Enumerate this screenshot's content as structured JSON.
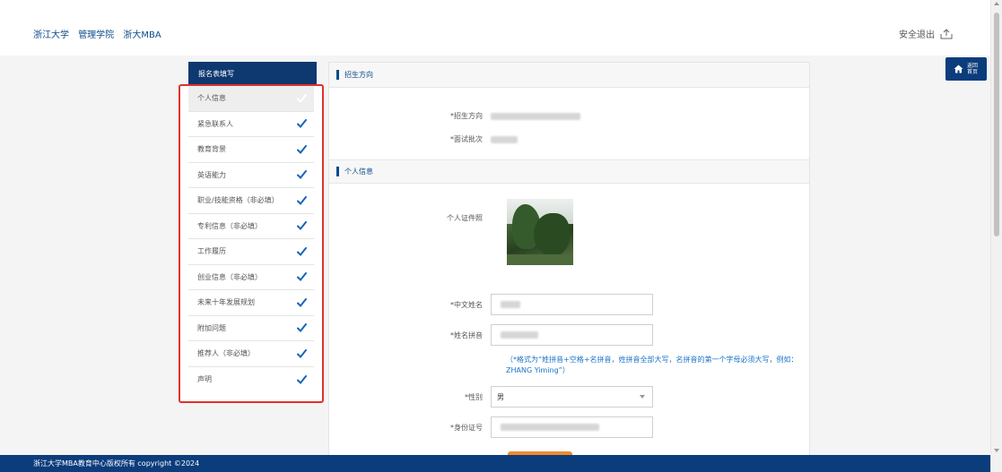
{
  "header": {
    "links": [
      "浙江大学",
      "管理学院",
      "浙大MBA"
    ],
    "logout_label": "安全退出"
  },
  "home_button": {
    "label": "返回首页"
  },
  "sidebar": {
    "title": "报名表填写",
    "items": [
      {
        "label": "个人信息",
        "done": true,
        "active": true
      },
      {
        "label": "紧急联系人",
        "done": true
      },
      {
        "label": "教育背景",
        "done": true
      },
      {
        "label": "英语能力",
        "done": true
      },
      {
        "label": "职业/技能资格（非必填）",
        "done": true
      },
      {
        "label": "专利信息（非必填）",
        "done": true
      },
      {
        "label": "工作履历",
        "done": true
      },
      {
        "label": "创业信息（非必填）",
        "done": true
      },
      {
        "label": "未来十年发展规划",
        "done": true
      },
      {
        "label": "附加问题",
        "done": true
      },
      {
        "label": "推荐人（非必填）",
        "done": true
      },
      {
        "label": "声明",
        "done": true
      }
    ]
  },
  "sections": {
    "direction": {
      "title": "招生方向",
      "direction_label": "*招生方向",
      "interview_label": "*面试批次"
    },
    "personal": {
      "title": "个人信息",
      "photo_label": "个人证件照",
      "chinese_name_label": "*中文姓名",
      "pinyin_label": "*姓名拼音",
      "pinyin_hint": "（*格式为“姓拼音+空格+名拼音，姓拼音全部大写，名拼音的第一个字母必须大写，例如：ZHANG Yiming”）",
      "gender_label": "*性别",
      "gender_value": "男",
      "id_label": "*身份证号"
    }
  },
  "footer": {
    "text": "浙江大学MBA教育中心版权所有 copyright ©2024"
  },
  "colors": {
    "primary": "#0b3c7c",
    "check": "#1565c0",
    "highlight_border": "#e0312b",
    "hint": "#1a73c9",
    "submit": "#f08a2b"
  }
}
